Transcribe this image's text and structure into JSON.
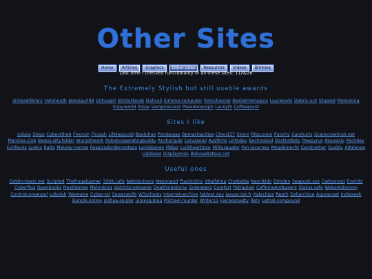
{
  "title": "Other Sites",
  "nav": [
    {
      "label": "Home"
    },
    {
      "label": "Articles"
    },
    {
      "label": "Graphics"
    },
    {
      "label": "Other Sites",
      "current": true
    },
    {
      "label": "Resources"
    },
    {
      "label": "Videos"
    },
    {
      "label": "Blinkies"
    }
  ],
  "checked_text": "Last time I checked functionality of all these sites: 11/4/26",
  "sections": [
    {
      "heading": "The Extremely Stylish but still usable awards",
      "links": [
        "sicksadlibrary",
        "Hellmouth",
        "Jeansgurl98",
        "Virtuagirl",
        "StickyHands",
        "Dalivali",
        "Simone.computer",
        "Kimichannel",
        "Realismomagico",
        "Lauraluvbi",
        "Dabric.xyz",
        "Stupied",
        "Melonking",
        "Espy.world",
        "Sdaw",
        "Vampiresnest",
        "Pseudeograph",
        "Lausyth",
        "Coffeeplant"
      ]
    },
    {
      "heading": "Sites I like",
      "links": [
        "Jutipia",
        "Shigo",
        "Cyberstheb",
        "Fwonsh",
        "Firozah",
        "Lifelesscold",
        "Beatchao",
        "Pombogay",
        "Bemachacities",
        "Chen157",
        "Strovi",
        "Ribo.zone",
        "Punchy",
        "Cainhurts",
        "Scarecrowknot.net",
        "Mancika.club",
        "Beaus.silly.folder",
        "Wunjotheork",
        "Roboticoperatingbuddy",
        "Anchorgutz",
        "Corussolel",
        "Avgfilms",
        "Lilithdev",
        "Bechmekid",
        "Doctordizzy",
        "Pawpyrus",
        "Akuwarai",
        "Michdey",
        "EvilReuts",
        "Lydels",
        "Ratts",
        "Melody-nomas",
        "Respiradordemostaza",
        "Lambbones",
        "Melps",
        "Lockheartlove",
        "Milkysqualor",
        "Pon-lacarney",
        "Megakmecht",
        "Candyether",
        "Gusblu",
        "Altalenae",
        "Ughbees",
        "Displayman",
        "Bokuwatetsuo.net"
      ]
    },
    {
      "heading": "Useful ones",
      "links": [
        "Goblin-heart.net",
        "Scripted",
        "Thefrugalgamer",
        "32bit.cafe",
        "Nekobuttons",
        "Melonland",
        "Plasticdino",
        "99gifshop",
        "Chattable",
        "Nenrikido",
        "Dimden",
        "Seapunk.xyz",
        "Cadnomori",
        "Evehibi",
        "Cyberflog",
        "Openbooks",
        "Neothemes",
        "Melonking",
        "districts.nekoweb",
        "Deathlobotomy",
        "Gutenberg",
        "Comfort",
        "Petrapixel",
        "CaffeineAndLasers",
        "Status.cafe",
        "Websetsbylynn",
        "Controlcoreangel",
        "Lobolab",
        "Werewire",
        "Cyber-rot",
        "Sewerwolfs",
        "W3schools",
        "Internet-archive",
        "fablest.day",
        "Javascript.fr",
        "Kalechips",
        "Repth",
        "Dollarchive",
        "Agoraroad",
        "Indieseek",
        "Bungle.online",
        "joshua.seigler",
        "jamesg.blog",
        "Michael-murder",
        "Writer13",
        "kieraoonadty",
        "Ilehr",
        "Lethal-compound"
      ]
    }
  ]
}
